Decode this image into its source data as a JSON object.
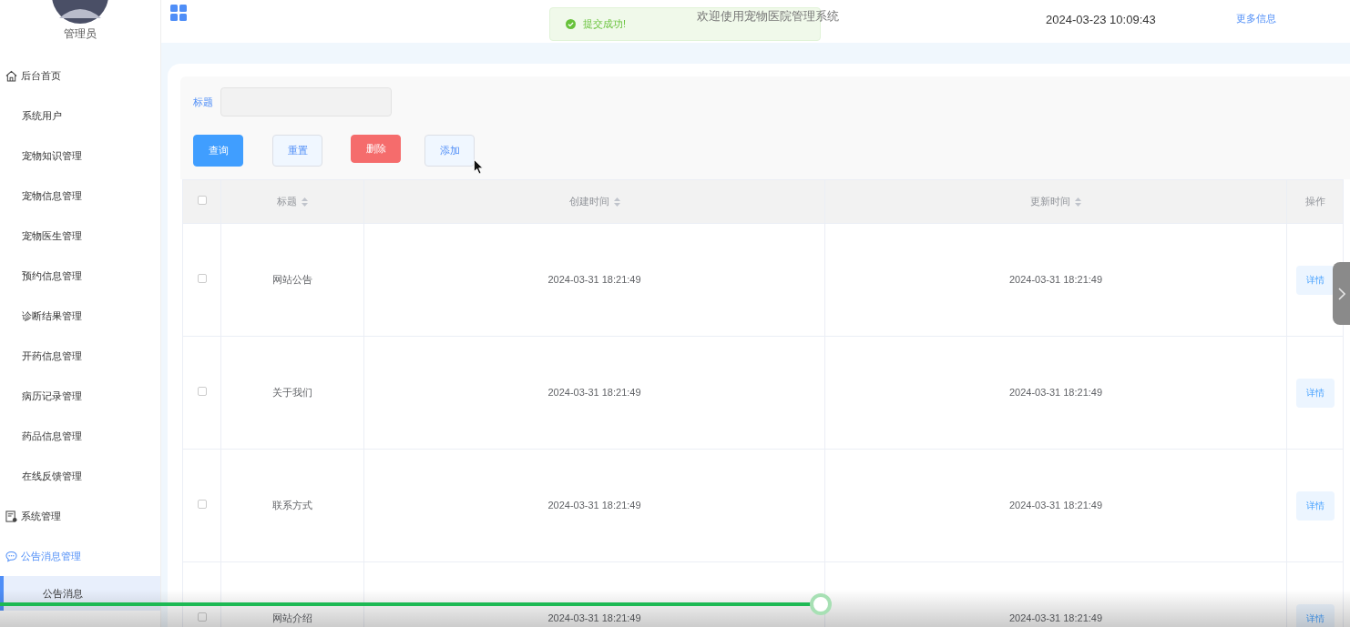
{
  "sidebar": {
    "user_name": "管理员",
    "items": [
      {
        "label": "后台首页",
        "active": false,
        "children": [
          {
            "label": "系统用户",
            "selected": false
          },
          {
            "label": "宠物知识管理",
            "selected": false
          },
          {
            "label": "宠物信息管理",
            "selected": false
          },
          {
            "label": "宠物医生管理",
            "selected": false
          },
          {
            "label": "预约信息管理",
            "selected": false
          },
          {
            "label": "诊断结果管理",
            "selected": false
          },
          {
            "label": "开药信息管理",
            "selected": false
          },
          {
            "label": "病历记录管理",
            "selected": false
          },
          {
            "label": "药品信息管理",
            "selected": false
          },
          {
            "label": "在线反馈管理",
            "selected": false
          }
        ]
      },
      {
        "label": "系统管理",
        "active": false
      },
      {
        "label": "公告消息管理",
        "active": true,
        "children": [
          {
            "label": "公告消息",
            "selected": true
          }
        ]
      }
    ]
  },
  "header": {
    "welcome": "欢迎使用宠物医院管理系统",
    "datetime": "2024-03-23 10:09:43",
    "more_link": "更多信息"
  },
  "toast": {
    "message": "提交成功!"
  },
  "filter": {
    "label": "标题"
  },
  "buttons": [
    {
      "label": "查询",
      "kind": "primary"
    },
    {
      "label": "重置",
      "kind": "plain"
    },
    {
      "label": "删除",
      "kind": "danger"
    },
    {
      "label": "添加",
      "kind": "plain"
    }
  ],
  "table": {
    "select_all_checked": false,
    "columns": [
      {
        "label": "标题",
        "sortable": true
      },
      {
        "label": "创建时间",
        "sortable": true
      },
      {
        "label": "更新时间",
        "sortable": true
      },
      {
        "label": "操作",
        "sortable": false
      }
    ],
    "rows": [
      {
        "checked": false,
        "title": "网站公告",
        "created": "2024-03-31 18:21:49",
        "updated": "2024-03-31 18:21:49",
        "action": "详情"
      },
      {
        "checked": false,
        "title": "关于我们",
        "created": "2024-03-31 18:21:49",
        "updated": "2024-03-31 18:21:49",
        "action": "详情"
      },
      {
        "checked": false,
        "title": "联系方式",
        "created": "2024-03-31 18:21:49",
        "updated": "2024-03-31 18:21:49",
        "action": "详情"
      },
      {
        "checked": false,
        "title": "网站介绍",
        "created": "2024-03-31 18:21:49",
        "updated": "2024-03-31 18:21:49",
        "action": "详情"
      }
    ]
  },
  "player": {
    "level": 0.608
  }
}
